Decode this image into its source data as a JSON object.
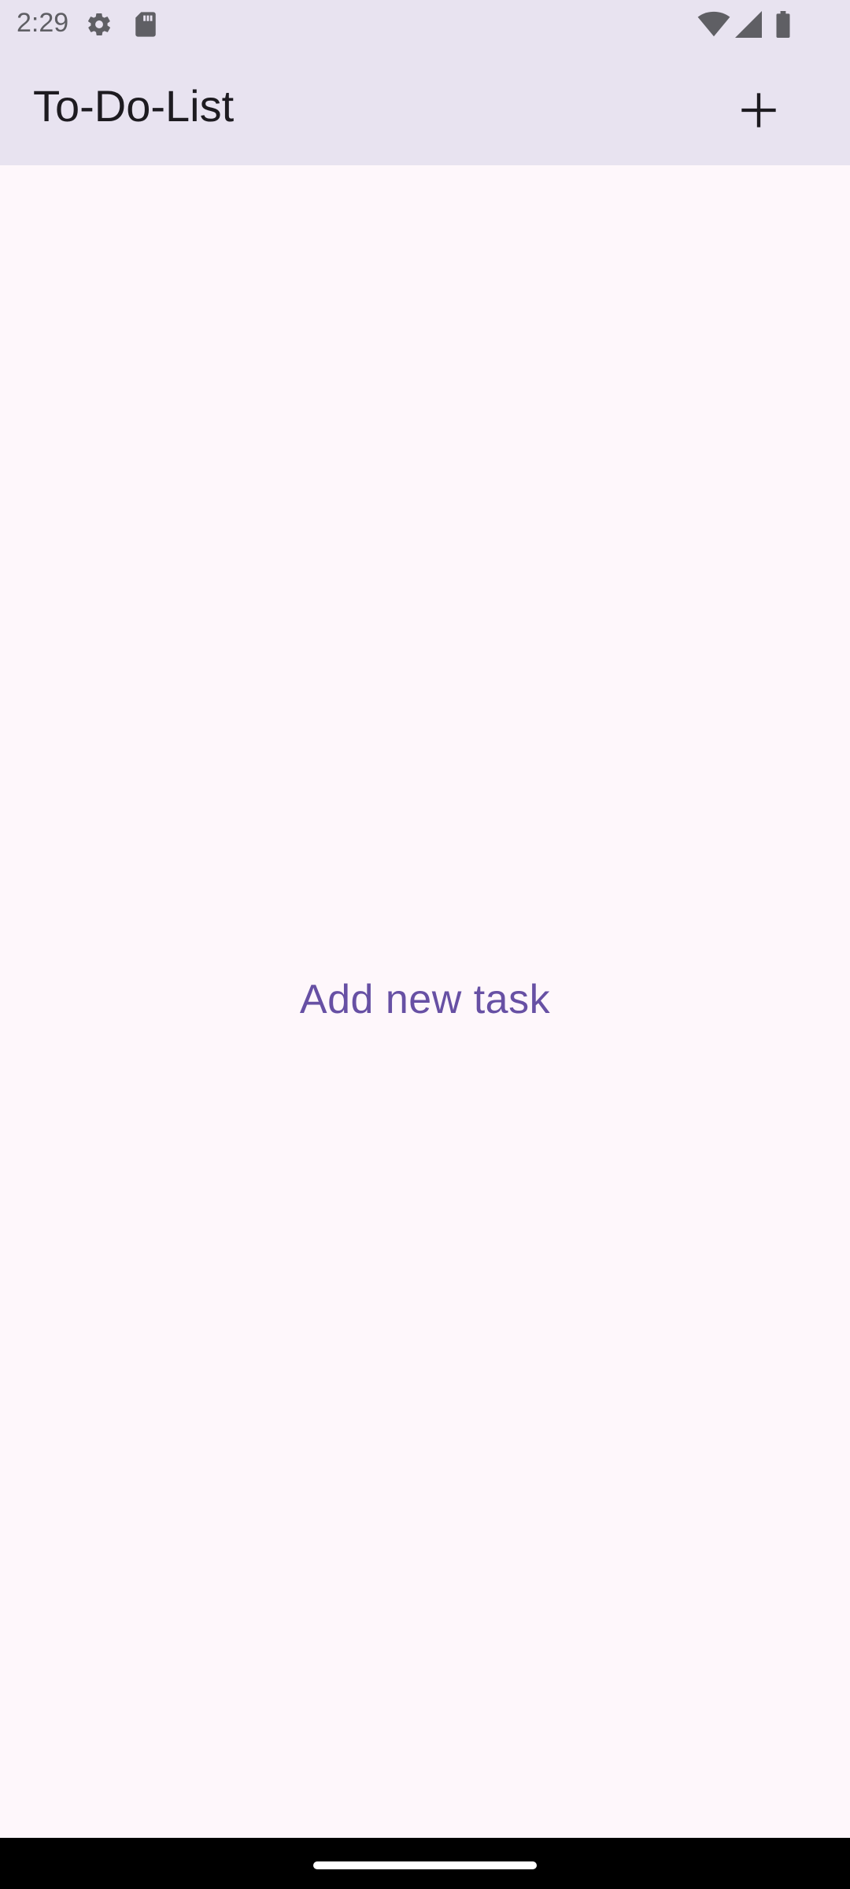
{
  "status_bar": {
    "time": "2:29",
    "left_icons": [
      "gear-icon",
      "sd-card-icon"
    ],
    "right_icons": [
      "wifi-icon",
      "cellular-signal-icon",
      "battery-icon"
    ]
  },
  "app_bar": {
    "title": "To-Do-List",
    "action_icon": "plus-icon"
  },
  "main": {
    "empty_prompt": "Add new task"
  },
  "colors": {
    "app_bar_bg": "#e8e3f0",
    "content_bg": "#fef7fb",
    "accent": "#6750a4",
    "title_text": "#1d1b20",
    "nav_bar_bg": "#000000"
  }
}
